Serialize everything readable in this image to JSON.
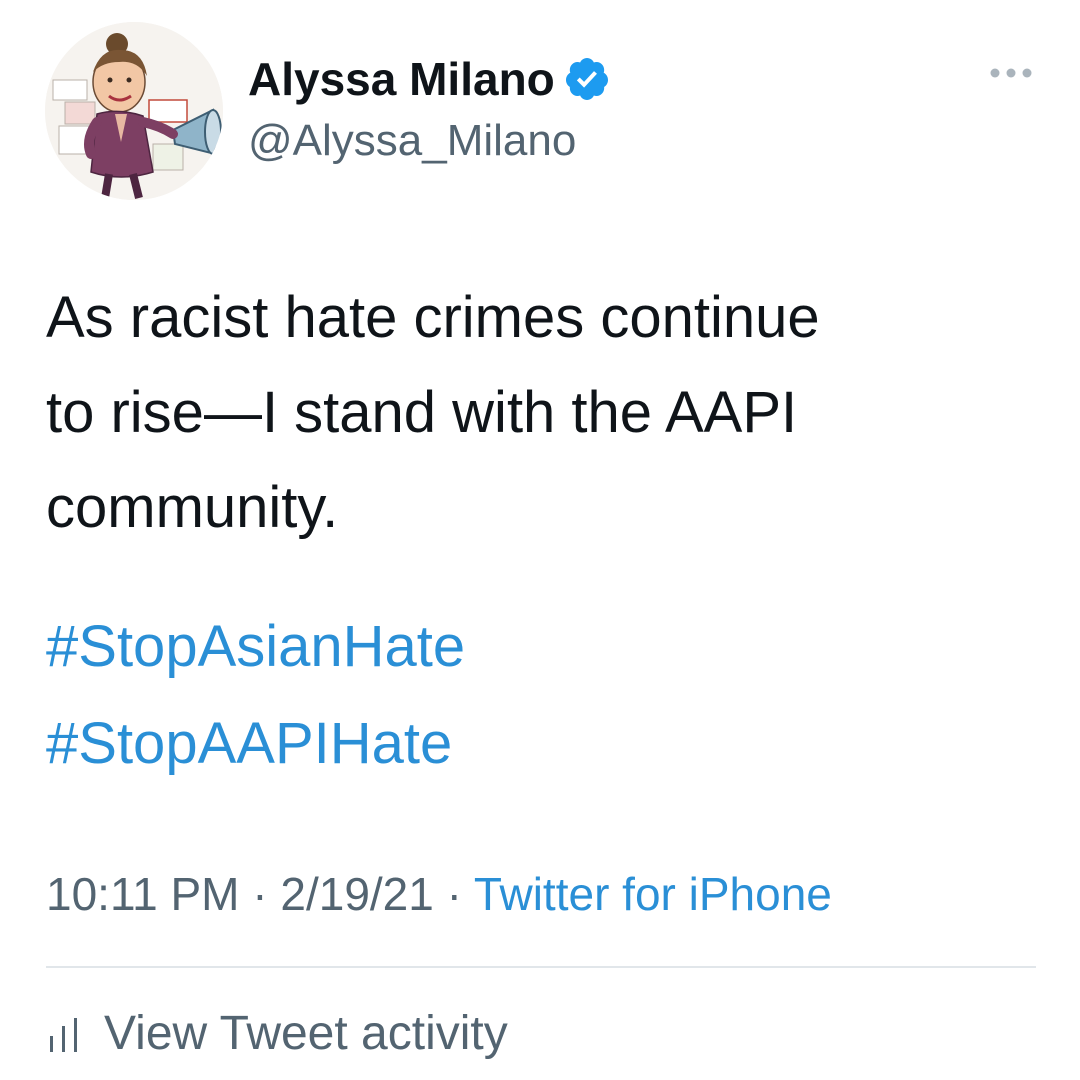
{
  "user": {
    "display_name": "Alyssa Milano",
    "handle": "@Alyssa_Milano",
    "verified": true,
    "avatar_icon": "caricature-avatar"
  },
  "tweet": {
    "text": "As racist hate crimes continue\nto rise—I stand with the AAPI\ncommunity.",
    "hashtags": [
      "#StopAsianHate",
      "#StopAAPIHate"
    ],
    "time": "10:11 PM",
    "date": "2/19/21",
    "separator": "·",
    "source": "Twitter for iPhone"
  },
  "actions": {
    "more_icon": "more-horizontal-icon",
    "view_activity_label": "View Tweet activity",
    "view_activity_icon": "bar-chart-icon"
  },
  "colors": {
    "text": "#0f1419",
    "secondary": "#536471",
    "link": "#2a8fd6",
    "verified": "#1d9bf0",
    "divider": "#e1e6ea"
  }
}
